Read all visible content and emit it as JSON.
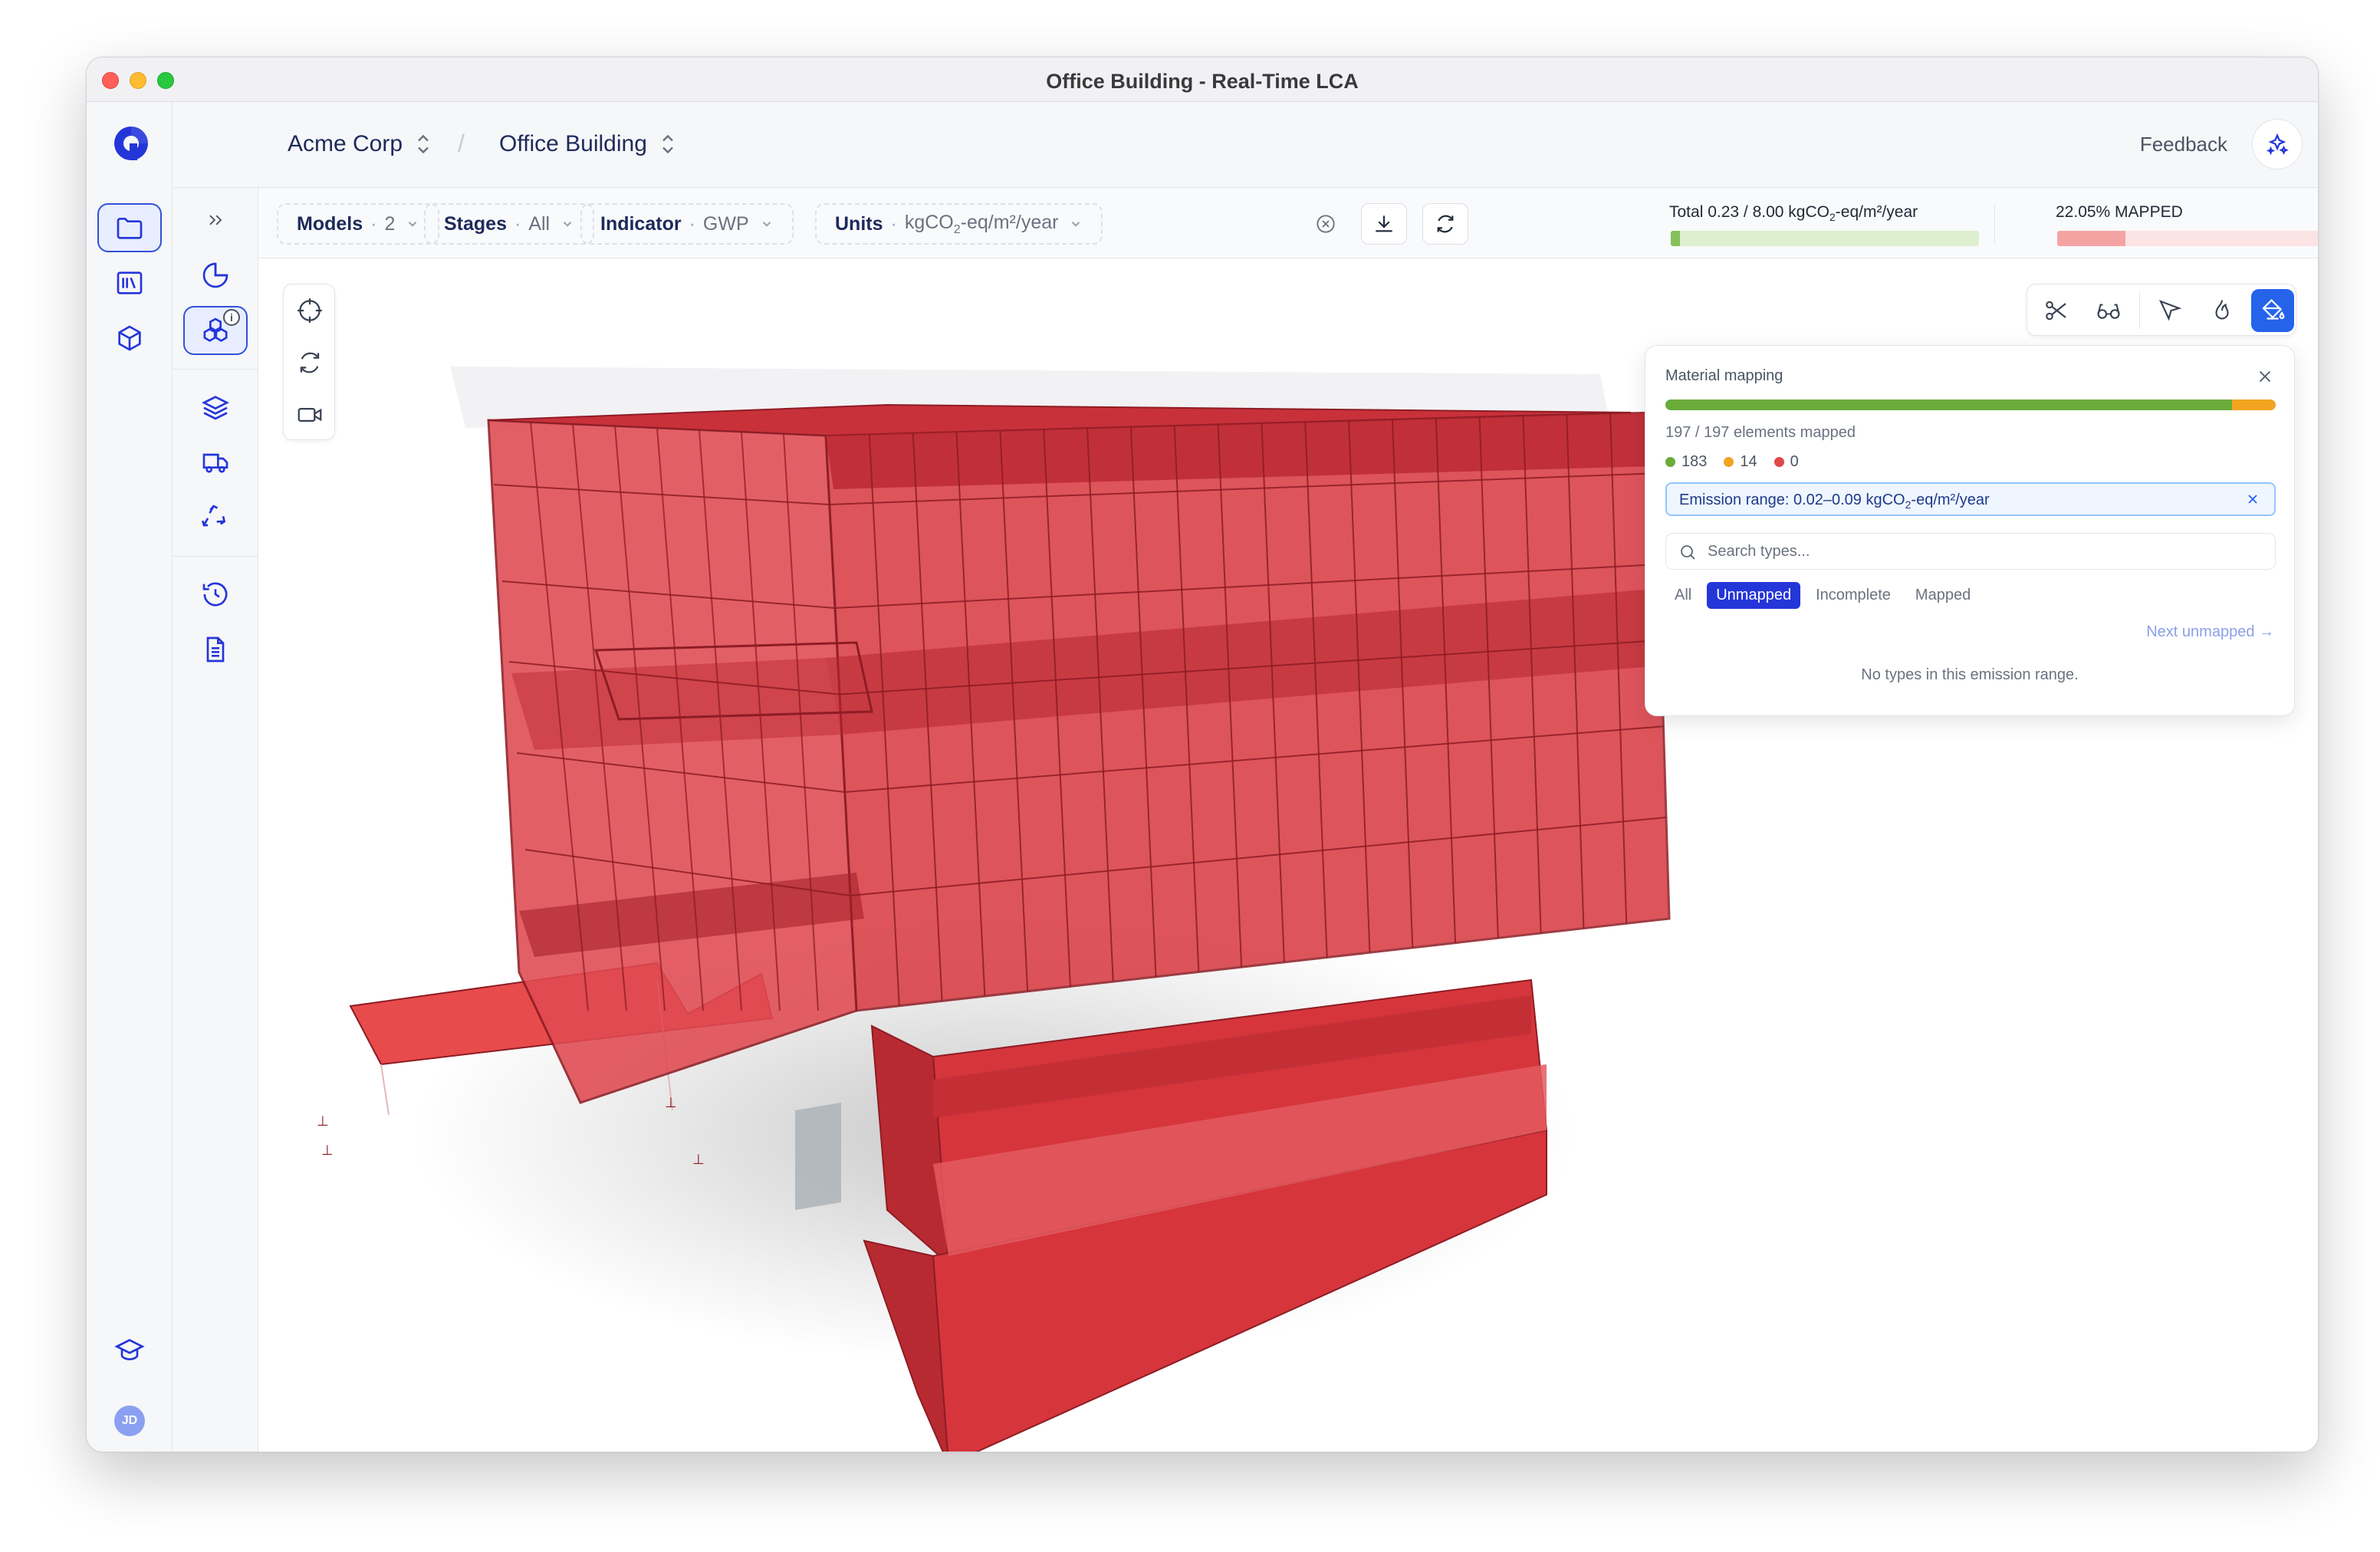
{
  "window": {
    "title": "Office Building - Real-Time LCA"
  },
  "header": {
    "org": "Acme Corp",
    "project": "Office Building",
    "feedback": "Feedback",
    "user_initials": "JD"
  },
  "toolbar": {
    "filters": [
      {
        "key": "Models",
        "value": "2"
      },
      {
        "key": "Stages",
        "value": "All"
      },
      {
        "key": "Indicator",
        "value": "GWP"
      },
      {
        "key": "Units",
        "value_prefix": "kgCO",
        "value_sub": "2",
        "value_suffix": "-eq/m²/year"
      }
    ],
    "total": {
      "label_prefix": "Total 0.23 / 8.00 kgCO",
      "label_sub": "2",
      "label_suffix": "-eq/m²/year",
      "fraction": 0.029,
      "fill_color": "#86c05a",
      "track_color": "#dcefcf"
    },
    "mapped": {
      "label": "22.05% MAPPED",
      "fraction": 0.2205,
      "fill_color": "#f4a3a3",
      "track_color": "#fce4e4"
    }
  },
  "panel": {
    "title": "Material mapping",
    "segments": [
      {
        "fraction": 0.929,
        "color": "#6aab3a"
      },
      {
        "fraction": 0.071,
        "color": "#f2a421"
      }
    ],
    "count_text": "197 / 197 elements mapped",
    "legend": [
      {
        "count": "183",
        "color": "#6aab3a"
      },
      {
        "count": "14",
        "color": "#f2a421"
      },
      {
        "count": "0",
        "color": "#e04848"
      }
    ],
    "range_prefix": "Emission range: 0.02–0.09 kgCO",
    "range_sub": "2",
    "range_suffix": "-eq/m²/year",
    "search_placeholder": "Search types...",
    "filters": [
      "All",
      "Unmapped",
      "Incomplete",
      "Mapped"
    ],
    "active_filter_index": 1,
    "next_link": "Next unmapped →",
    "empty_text": "No types in this emission range."
  },
  "colors": {
    "accent": "#2563eb",
    "brand": "#2536d9",
    "model_fill": "#d9373f",
    "model_dark": "#8e1c24"
  },
  "icons": {
    "rail": [
      "folder-icon",
      "library-icon",
      "cube-icon",
      "graduation-cap-icon"
    ],
    "side": [
      "chevrons-right-icon",
      "pie-chart-icon",
      "boxes-icon",
      "layers-icon",
      "truck-icon",
      "recycle-icon",
      "history-icon",
      "document-icon",
      "sliders-icon"
    ],
    "view_tools": [
      "scissors-icon",
      "glasses-icon",
      "cursor-icon",
      "flame-icon",
      "paint-bucket-icon"
    ],
    "nav_tools": [
      "crosshair-icon",
      "rotate-icon",
      "camera-icon"
    ]
  }
}
